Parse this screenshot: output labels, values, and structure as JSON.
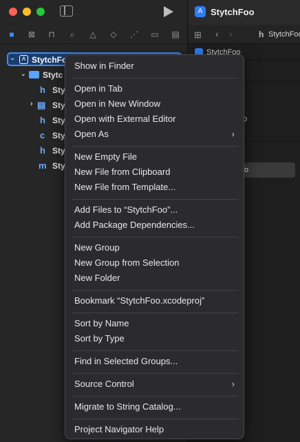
{
  "window": {
    "editor_title": "StytchFoo"
  },
  "navigator": {
    "tree": [
      {
        "label": "StytchFoo",
        "icon": "xcodeproj-icon"
      },
      {
        "label": "Stytc",
        "icon": "folder-icon"
      },
      {
        "label": "Sty",
        "icon": "h-file-icon",
        "glyph": "h"
      },
      {
        "label": "Sty",
        "icon": "framework-icon",
        "glyph": "▤"
      },
      {
        "label": "Sty",
        "icon": "h-file-icon",
        "glyph": "h"
      },
      {
        "label": "Sty",
        "icon": "c-file-icon",
        "glyph": "c"
      },
      {
        "label": "Sty",
        "icon": "h-file-icon",
        "glyph": "h"
      },
      {
        "label": "Sty",
        "icon": "m-file-icon",
        "glyph": "m"
      }
    ]
  },
  "editor": {
    "jumpbar_file": "StytchFoo",
    "sub_label": "StytchFoo",
    "frag_o": "o",
    "frag_selected": "o"
  },
  "menu": {
    "items": {
      "show_in_finder": "Show in Finder",
      "open_in_tab": "Open in Tab",
      "open_in_new_window": "Open in New Window",
      "open_with_external_editor": "Open with External Editor",
      "open_as": "Open As",
      "new_empty_file": "New Empty File",
      "new_file_from_clipboard": "New File from Clipboard",
      "new_file_from_template": "New File from Template...",
      "add_files": "Add Files to “StytchFoo”...",
      "add_package_dependencies": "Add Package Dependencies...",
      "new_group": "New Group",
      "new_group_from_selection": "New Group from Selection",
      "new_folder": "New Folder",
      "bookmark": "Bookmark “StytchFoo.xcodeproj”",
      "sort_by_name": "Sort by Name",
      "sort_by_type": "Sort by Type",
      "find_in_selected_groups": "Find in Selected Groups...",
      "source_control": "Source Control",
      "migrate_to_string_catalog": "Migrate to String Catalog...",
      "project_navigator_help": "Project Navigator Help"
    }
  },
  "colors": {
    "accent": "#3d8ef8",
    "menu_bg": "#2b2b2d"
  }
}
